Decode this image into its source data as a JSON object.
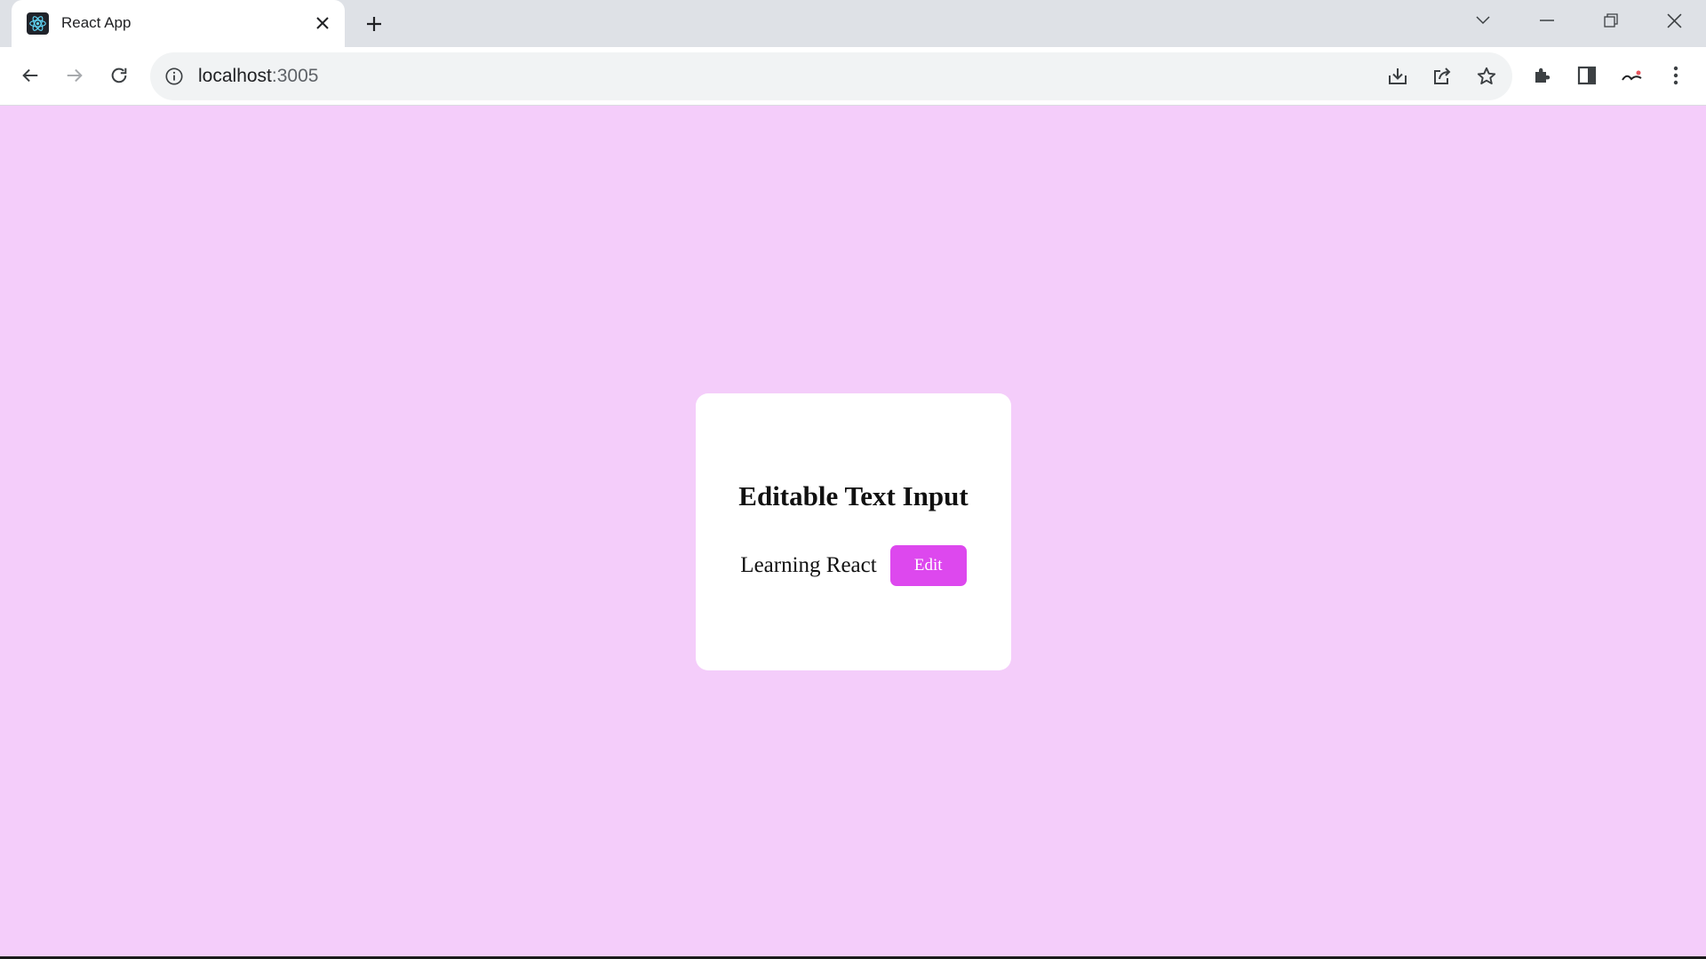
{
  "browser": {
    "tab_title": "React App",
    "url_host": "localhost",
    "url_port": ":3005",
    "icons": [
      "react-favicon-icon",
      "close-icon",
      "plus-icon",
      "chevron-down-icon",
      "minimize-icon",
      "restore-icon",
      "window-close-icon",
      "back-arrow-icon",
      "forward-arrow-icon",
      "reload-icon",
      "info-icon",
      "download-icon",
      "share-icon",
      "star-icon",
      "puzzle-icon",
      "side-panel-icon",
      "profile-icon",
      "kebab-menu-icon"
    ]
  },
  "colors": {
    "page_background": "#f4cdfa",
    "card_background": "#ffffff",
    "button_background": "#dd48ee",
    "button_text": "#ffffff"
  },
  "card": {
    "title": "Editable Text Input",
    "text": "Learning React",
    "edit_label": "Edit"
  }
}
